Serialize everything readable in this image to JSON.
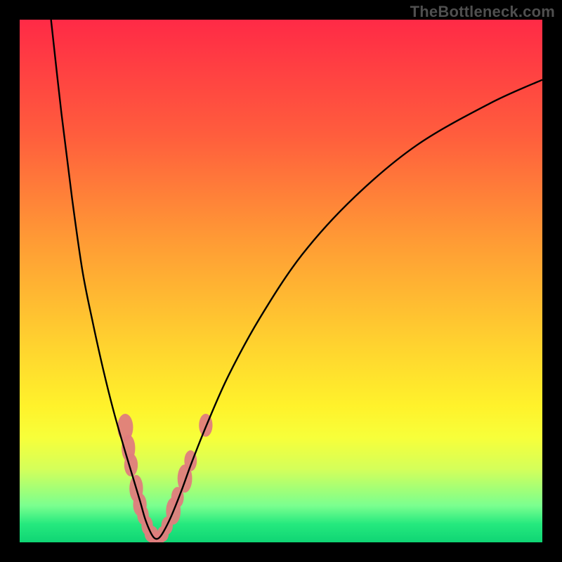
{
  "watermark": "TheBottleneck.com",
  "colors": {
    "frame": "#000000",
    "curve": "#000000",
    "marker_fill": "#df7d7d",
    "marker_stroke": "#df7d7d",
    "gradient_stops": [
      {
        "offset": 0.0,
        "color": "#ff2a46"
      },
      {
        "offset": 0.22,
        "color": "#ff5d3d"
      },
      {
        "offset": 0.42,
        "color": "#ff9a35"
      },
      {
        "offset": 0.62,
        "color": "#ffd22f"
      },
      {
        "offset": 0.74,
        "color": "#fff22b"
      },
      {
        "offset": 0.8,
        "color": "#f7ff3a"
      },
      {
        "offset": 0.86,
        "color": "#d4ff5a"
      },
      {
        "offset": 0.93,
        "color": "#7aff8f"
      },
      {
        "offset": 0.965,
        "color": "#25e97e"
      },
      {
        "offset": 1.0,
        "color": "#0fd574"
      }
    ]
  },
  "chart_data": {
    "type": "line",
    "title": "",
    "xlabel": "",
    "ylabel": "",
    "xlim": [
      0,
      100
    ],
    "ylim": [
      0,
      100
    ],
    "note": "Bottleneck-style V-curve. y is visually mapped so 0 at the green band (bottom) and 100 at the red band (top). x is the horizontal parameter.",
    "series": [
      {
        "name": "bottleneck-curve",
        "x": [
          6.0,
          8.0,
          10.0,
          12.0,
          14.0,
          16.0,
          18.0,
          20.0,
          21.5,
          23.0,
          24.0,
          25.0,
          25.8,
          26.6,
          27.5,
          29.0,
          31.0,
          33.0,
          36.0,
          40.0,
          46.0,
          54.0,
          64.0,
          76.0,
          90.0,
          100.0
        ],
        "y": [
          100.0,
          82.0,
          66.0,
          52.0,
          42.0,
          33.0,
          25.0,
          18.0,
          13.0,
          8.0,
          4.5,
          2.0,
          0.8,
          0.8,
          2.0,
          5.0,
          10.0,
          15.5,
          23.0,
          32.0,
          43.0,
          55.0,
          66.0,
          76.0,
          84.0,
          88.5
        ]
      }
    ],
    "markers": {
      "name": "data-points",
      "note": "Highlighted ovals clustered around the curve minimum region.",
      "points": [
        {
          "x": 20.2,
          "y": 22.0,
          "rx": 1.5,
          "ry": 2.6
        },
        {
          "x": 20.8,
          "y": 18.0,
          "rx": 1.3,
          "ry": 2.6
        },
        {
          "x": 21.3,
          "y": 14.8,
          "rx": 1.3,
          "ry": 2.2
        },
        {
          "x": 22.3,
          "y": 10.3,
          "rx": 1.3,
          "ry": 2.6
        },
        {
          "x": 23.0,
          "y": 7.2,
          "rx": 1.3,
          "ry": 2.2
        },
        {
          "x": 23.6,
          "y": 5.2,
          "rx": 1.1,
          "ry": 1.8
        },
        {
          "x": 24.4,
          "y": 3.2,
          "rx": 1.1,
          "ry": 1.8
        },
        {
          "x": 25.2,
          "y": 1.6,
          "rx": 1.3,
          "ry": 1.6
        },
        {
          "x": 25.8,
          "y": 0.7,
          "rx": 1.1,
          "ry": 1.3
        },
        {
          "x": 26.6,
          "y": 0.7,
          "rx": 1.1,
          "ry": 1.3
        },
        {
          "x": 27.4,
          "y": 1.6,
          "rx": 1.1,
          "ry": 1.5
        },
        {
          "x": 28.2,
          "y": 3.2,
          "rx": 1.1,
          "ry": 1.7
        },
        {
          "x": 29.4,
          "y": 6.0,
          "rx": 1.4,
          "ry": 2.6
        },
        {
          "x": 30.2,
          "y": 8.6,
          "rx": 1.2,
          "ry": 2.0
        },
        {
          "x": 31.6,
          "y": 12.2,
          "rx": 1.4,
          "ry": 2.7
        },
        {
          "x": 32.7,
          "y": 15.6,
          "rx": 1.2,
          "ry": 2.0
        },
        {
          "x": 35.6,
          "y": 22.4,
          "rx": 1.3,
          "ry": 2.2
        }
      ]
    }
  }
}
